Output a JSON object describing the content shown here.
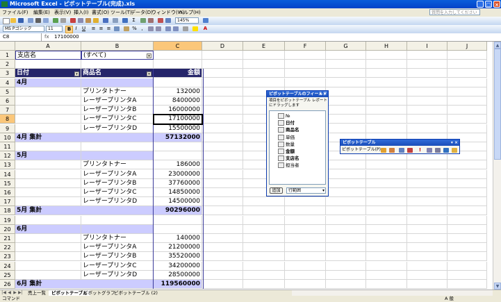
{
  "window": {
    "title": "Microsoft Excel - ピボットテーブル(完成).xls"
  },
  "menu": {
    "items": [
      "ファイル(F)",
      "編集(E)",
      "表示(V)",
      "挿入(I)",
      "書式(O)",
      "ツール(T)",
      "データ(D)",
      "ウィンドウ(W)",
      "ヘルプ(H)"
    ],
    "help_placeholder": "質問を入力してください"
  },
  "toolbar": {
    "font_name": "MS Pゴシック",
    "font_size": "11",
    "zoom": "145%"
  },
  "formula_bar": {
    "name_box": "C8",
    "fx": "fx",
    "value": "17100000"
  },
  "columns": [
    "A",
    "B",
    "C",
    "D",
    "E",
    "F",
    "G",
    "H",
    "I",
    "J"
  ],
  "rows": [
    "1",
    "2",
    "3",
    "4",
    "5",
    "6",
    "7",
    "8",
    "9",
    "10",
    "11",
    "12",
    "13",
    "14",
    "15",
    "16",
    "17",
    "18",
    "19",
    "20",
    "21",
    "22",
    "23",
    "24",
    "25",
    "26"
  ],
  "pivot": {
    "page_field_label": "支店名",
    "page_field_value": "(すべて)",
    "header_date": "日付",
    "header_product": "商品名",
    "header_amount": "金額",
    "groups": [
      {
        "month": "4月",
        "total_label": "4月 集計",
        "total": "57132000",
        "items": [
          {
            "product": "プリンタトナー",
            "amount": "132000"
          },
          {
            "product": "レーザープリンタA",
            "amount": "8400000"
          },
          {
            "product": "レーザープリンタB",
            "amount": "16000000"
          },
          {
            "product": "レーザープリンタC",
            "amount": "17100000"
          },
          {
            "product": "レーザープリンタD",
            "amount": "15500000"
          }
        ]
      },
      {
        "month": "5月",
        "total_label": "5月 集計",
        "total": "90296000",
        "items": [
          {
            "product": "プリンタトナー",
            "amount": "186000"
          },
          {
            "product": "レーザープリンタA",
            "amount": "23000000"
          },
          {
            "product": "レーザープリンタB",
            "amount": "37760000"
          },
          {
            "product": "レーザープリンタC",
            "amount": "14850000"
          },
          {
            "product": "レーザープリンタD",
            "amount": "14500000"
          }
        ]
      },
      {
        "month": "6月",
        "total_label": "6月 集計",
        "total": "119560000",
        "items": [
          {
            "product": "プリンタトナー",
            "amount": "140000"
          },
          {
            "product": "レーザープリンタA",
            "amount": "21200000"
          },
          {
            "product": "レーザープリンタB",
            "amount": "35520000"
          },
          {
            "product": "レーザープリンタC",
            "amount": "34200000"
          },
          {
            "product": "レーザープリンタD",
            "amount": "28500000"
          }
        ]
      }
    ]
  },
  "field_list": {
    "title": "ピボットテーブルのフィールド",
    "instruction": "項目をピボットテーブル レポートにドラッグします",
    "fields": [
      "№",
      "日付",
      "商品名",
      "単価",
      "数量",
      "金額",
      "支店名",
      "担当者"
    ],
    "add_button": "追加",
    "area_select": "行範囲"
  },
  "pivot_toolbar": {
    "title": "ピボットテーブル",
    "menu_button": "ピボットテーブル(P)"
  },
  "sheet_tabs": [
    "売上一覧",
    "ピボットテーブル",
    "ピボットグラフ",
    "ピボットテーブル (2)"
  ],
  "status": {
    "left": "コマンド",
    "ime": "A 般"
  },
  "colors": {
    "header_band": "#25256a",
    "subtotal_band": "#ccccff",
    "title_bar": "#0a5ddb"
  }
}
